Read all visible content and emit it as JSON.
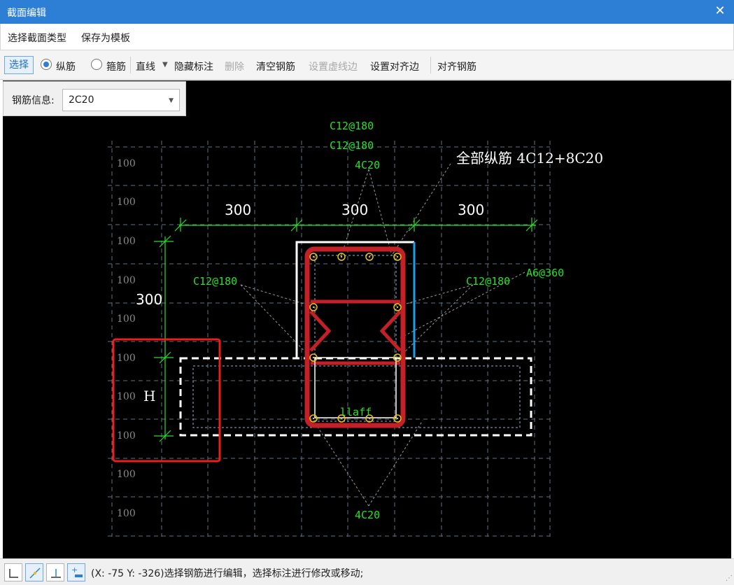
{
  "window": {
    "title": "截面编辑",
    "close_glyph": "✕"
  },
  "menu": {
    "items": [
      "选择截面类型",
      "保存为模板"
    ]
  },
  "toolbar": {
    "select": "选择",
    "longitudinal": "纵筋",
    "stirrup": "箍筋",
    "line": "直线",
    "hide_annotation": "隐藏标注",
    "delete": "删除",
    "clear_rebar": "清空钢筋",
    "set_dashed_edge": "设置虚线边",
    "set_align_edge": "设置对齐边",
    "align_rebar": "对齐钢筋",
    "selected_radio": "纵筋"
  },
  "rebar_info": {
    "label": "钢筋信息:",
    "value": "2C20"
  },
  "drawing": {
    "annotations": {
      "top_stirrup_1": "C12@180",
      "top_stirrup_2": "C12@180",
      "top_long": "4C20",
      "summary": "全部纵筋 4C12+8C20",
      "left_stirrup": "C12@180",
      "right_stirrup": "C12@180",
      "tie": "A6@360",
      "bottom_long": "4C20",
      "laf": "llaff"
    },
    "dimensions": {
      "left_width": "300",
      "mid_width": "300",
      "right_width": "300",
      "height": "300",
      "h_label": "H"
    },
    "grid_labels": [
      "100",
      "100",
      "100",
      "100",
      "100",
      "100",
      "100",
      "100",
      "100",
      "100"
    ],
    "colors": {
      "background": "#000000",
      "grid": "#5f6f7f",
      "annotation_green": "#27e027",
      "stirrup_red": "#c42027",
      "highlight_red": "#ee1c1c",
      "outline_white": "#ffffff",
      "edge_blue": "#1ea0e8",
      "rebar_yellow": "#e8c21b",
      "dim_green": "#27e027"
    }
  },
  "statusbar": {
    "coords": "(X: -75 Y: -326)",
    "message": "选择钢筋进行编辑，选择标注进行修改或移动;"
  }
}
